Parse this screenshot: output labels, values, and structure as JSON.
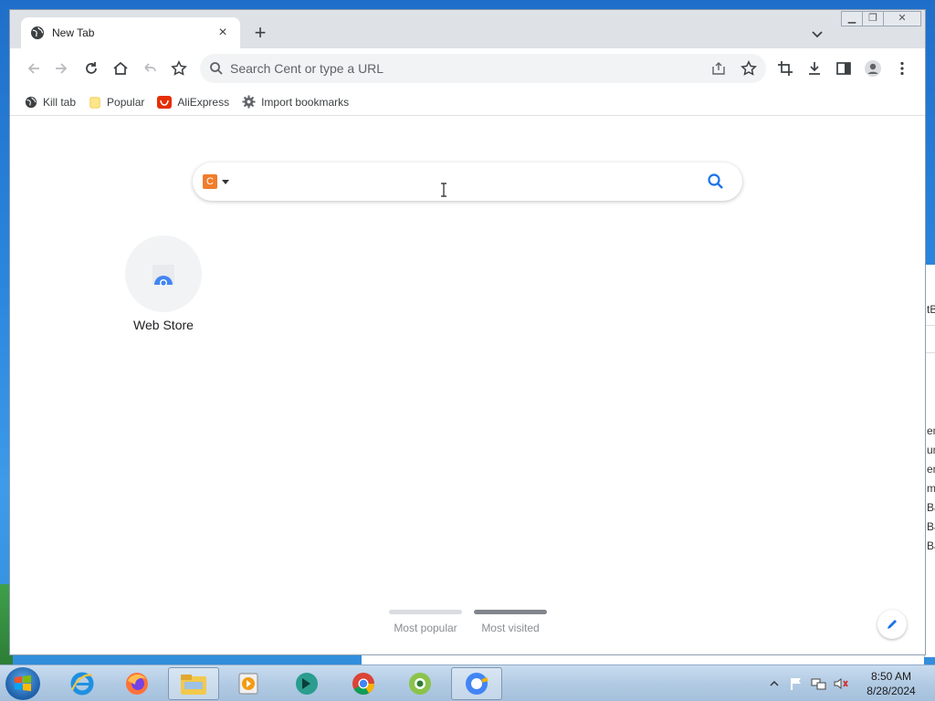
{
  "tab": {
    "title": "New Tab",
    "close": "×"
  },
  "window": {
    "minimize": "▁",
    "maximize": "❐",
    "close": "✕"
  },
  "toolbar": {
    "omnibox_placeholder": "Search Cent or type a URL",
    "icons": [
      "back-icon",
      "forward-icon",
      "reload-icon",
      "home-icon",
      "undo-icon",
      "star-icon",
      "share-icon",
      "bookmark-star-icon",
      "crop-icon",
      "download-icon",
      "side-panel-icon",
      "profile-icon",
      "menu-icon"
    ]
  },
  "bookmarks": [
    {
      "label": "Kill tab",
      "icon": "globe-icon"
    },
    {
      "label": "Popular",
      "icon": "folder-icon"
    },
    {
      "label": "AliExpress",
      "icon": "aliexpress-icon"
    },
    {
      "label": "Import bookmarks",
      "icon": "gear-icon"
    }
  ],
  "ntp": {
    "search_placeholder": "",
    "shortcut": {
      "label": "Web Store"
    },
    "toggles": [
      {
        "label": "Most popular",
        "active": false
      },
      {
        "label": "Most visited",
        "active": true
      }
    ]
  },
  "colors": {
    "accent": "#1a73e8",
    "tabstrip": "#dee1e6",
    "toggle_active": "#80868b",
    "toggle_inactive": "#dadce0"
  },
  "taskbar": {
    "apps": [
      "internet-explorer-icon",
      "firefox-icon",
      "file-explorer-icon",
      "media-player-icon",
      "maxthon-icon",
      "chrome-icon",
      "coc-coc-icon",
      "cent-browser-icon"
    ],
    "time": "8:50 AM",
    "date": "8/28/2024"
  },
  "background_window_text": [
    "tB",
    "en",
    "um",
    "en",
    "m",
    "Ba",
    "Ba",
    "Ba"
  ]
}
